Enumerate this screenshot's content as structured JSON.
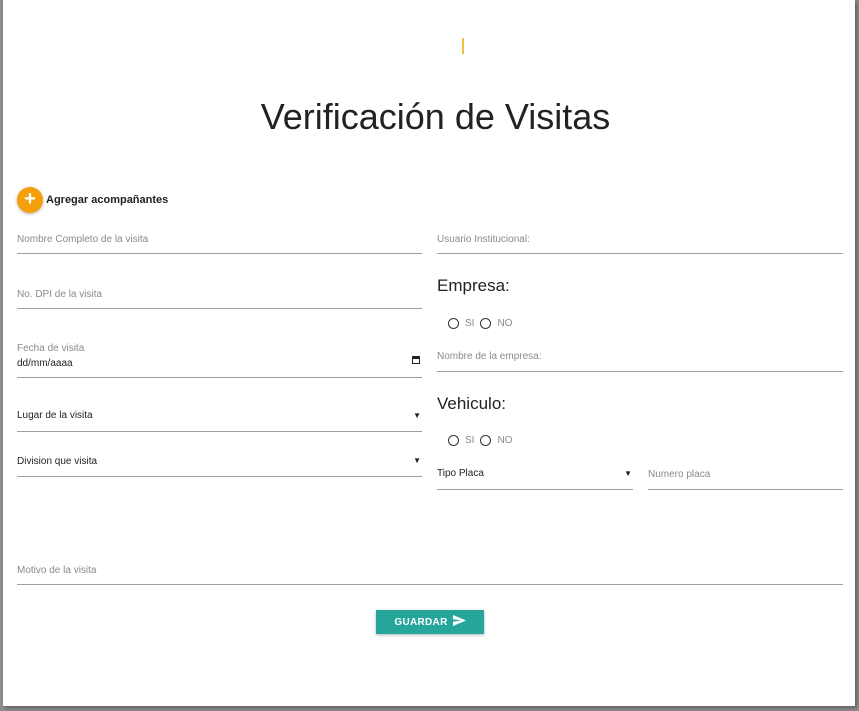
{
  "title": "Verificación de Visitas",
  "add_companions": {
    "icon": "plus-icon",
    "label": "Agregar acompañantes"
  },
  "left_fields": {
    "nombre_placeholder": "Nombre Completo de la visita",
    "dpi_placeholder": "No. DPI de la visita",
    "fecha_label": "Fecha de visita",
    "fecha_value": "dd/mm/aaaa",
    "lugar_selected": "Lugar de la visita",
    "division_selected": "Division que visita"
  },
  "right_fields": {
    "usuario_placeholder": "Usuario Institucional:",
    "empresa_heading": "Empresa:",
    "empresa_options": [
      "SI",
      "NO"
    ],
    "empresa_nombre_placeholder": "Nombre de la empresa:",
    "vehiculo_heading": "Vehiculo:",
    "vehiculo_options": [
      "SI",
      "NO"
    ],
    "tipo_placa_selected": "Tipo Placa",
    "numero_placa_placeholder": "Numero placa"
  },
  "motivo_placeholder": "Motivo de la visita",
  "save_button": {
    "label": "GUARDAR",
    "icon": "send-icon"
  },
  "colors": {
    "accent_orange": "#f5a00a",
    "button_teal": "#26a69a",
    "underline": "#9e9e9e"
  }
}
